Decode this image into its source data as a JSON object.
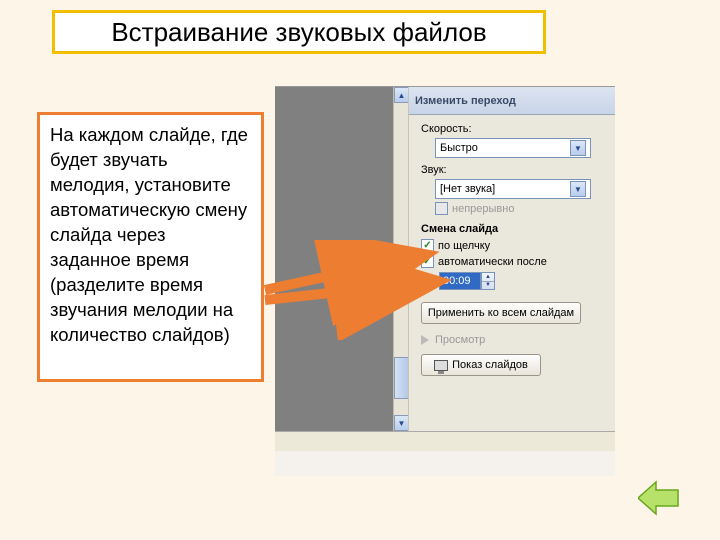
{
  "title": "Встраивание звуковых файлов",
  "instruction": "На каждом слайде, где будет звучать мелодия, установите автоматическую смену слайда через заданное время (разделите время звучания мелодии на количество слайдов)",
  "taskpane": {
    "header": "Изменить переход",
    "speed_label": "Скорость:",
    "speed_value": "Быстро",
    "sound_label": "Звук:",
    "sound_value": "[Нет звука]",
    "loop_label": "непрерывно",
    "advance_header": "Смена слайда",
    "on_click_label": "по щелчку",
    "auto_after_label": "автоматически после",
    "time_value": "00:09",
    "apply_all": "Применить ко всем слайдам",
    "preview": "Просмотр",
    "slideshow": "Показ слайдов"
  },
  "icons": {
    "back": "back-arrow"
  }
}
